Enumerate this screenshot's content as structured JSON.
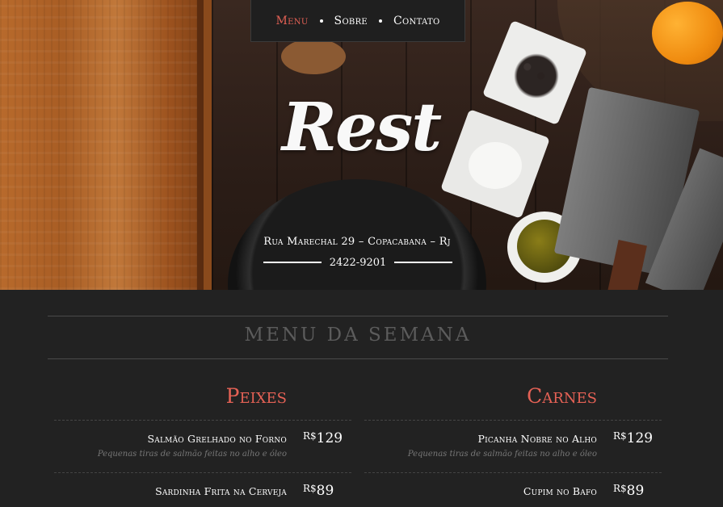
{
  "nav": {
    "items": [
      {
        "label": "Menu",
        "active": true
      },
      {
        "label": "Sobre",
        "active": false
      },
      {
        "label": "Contato",
        "active": false
      }
    ]
  },
  "hero": {
    "logo": "Rest",
    "address": "Rua Marechal 29 – Copacabana – Rj",
    "phone": "2422-9201"
  },
  "menu": {
    "title": "MENU DA SEMANA",
    "columns": [
      {
        "title": "Peixes",
        "items": [
          {
            "name": "Salmão Grelhado no Forno",
            "desc": "Pequenas tiras de salmão feitas no alho e óleo",
            "currency": "R$",
            "price": "129"
          },
          {
            "name": "Sardinha Frita na Cerveja",
            "desc": "",
            "currency": "R$",
            "price": "89"
          }
        ]
      },
      {
        "title": "Carnes",
        "items": [
          {
            "name": "Picanha Nobre no Alho",
            "desc": "Pequenas tiras de salmão feitas no alho e óleo",
            "currency": "R$",
            "price": "129"
          },
          {
            "name": "Cupim no Bafo",
            "desc": "",
            "currency": "R$",
            "price": "89"
          }
        ]
      }
    ]
  },
  "colors": {
    "accent": "#e46155",
    "background": "#222222",
    "muted": "#5c5c5c"
  }
}
